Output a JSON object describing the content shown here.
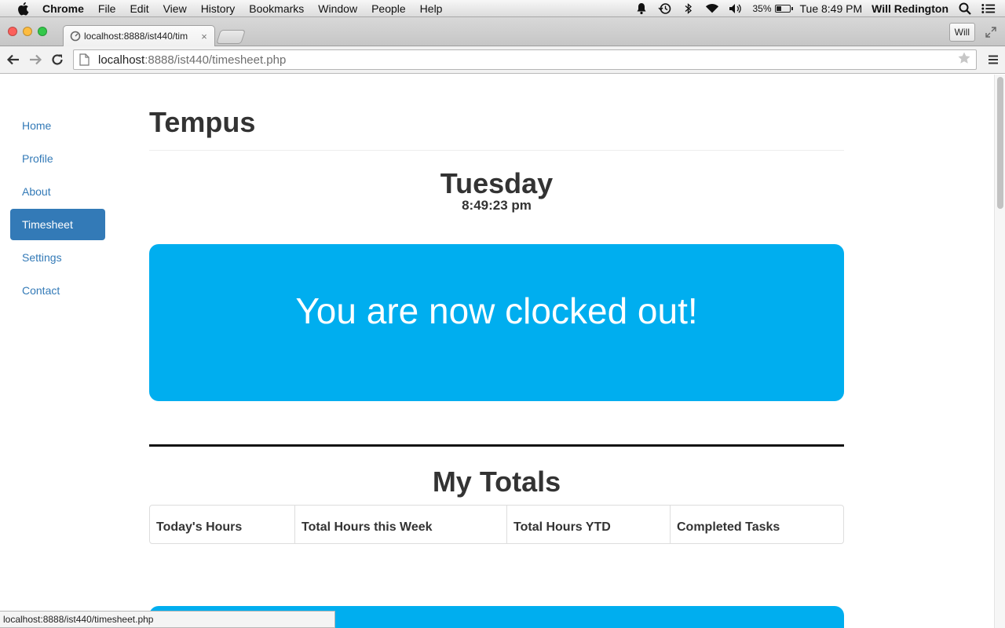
{
  "menubar": {
    "app_name": "Chrome",
    "menus": [
      "File",
      "Edit",
      "View",
      "History",
      "Bookmarks",
      "Window",
      "People",
      "Help"
    ],
    "battery_percent": "35%",
    "battery_level": 0.35,
    "clock": "Tue 8:49 PM",
    "user": "Will Redington",
    "status_icons": [
      "notification-icon",
      "time-machine-icon",
      "bluetooth-icon",
      "wifi-icon",
      "volume-icon",
      "battery-icon",
      "spotlight-icon",
      "notification-center-icon"
    ]
  },
  "browser": {
    "tab_title": "localhost:8888/ist440/tim",
    "tab_close": "×",
    "profile_label": "Will",
    "url_host": "localhost",
    "url_rest": ":8888/ist440/timesheet.php",
    "status_url": "localhost:8888/ist440/timesheet.php"
  },
  "sidebar": {
    "items": [
      {
        "label": "Home",
        "active": false
      },
      {
        "label": "Profile",
        "active": false
      },
      {
        "label": "About",
        "active": false
      },
      {
        "label": "Timesheet",
        "active": true
      },
      {
        "label": "Settings",
        "active": false
      },
      {
        "label": "Contact",
        "active": false
      }
    ]
  },
  "main": {
    "brand": "Tempus",
    "day": "Tuesday",
    "time": "8:49:23 pm",
    "status_message": "You are now clocked out!",
    "totals_title": "My Totals",
    "totals_headers": [
      "Today's Hours",
      "Total Hours this Week",
      "Total Hours YTD",
      "Completed Tasks"
    ]
  },
  "colors": {
    "accent_blue": "#00aeef",
    "nav_active": "#337ab7",
    "link": "#337ab7"
  }
}
